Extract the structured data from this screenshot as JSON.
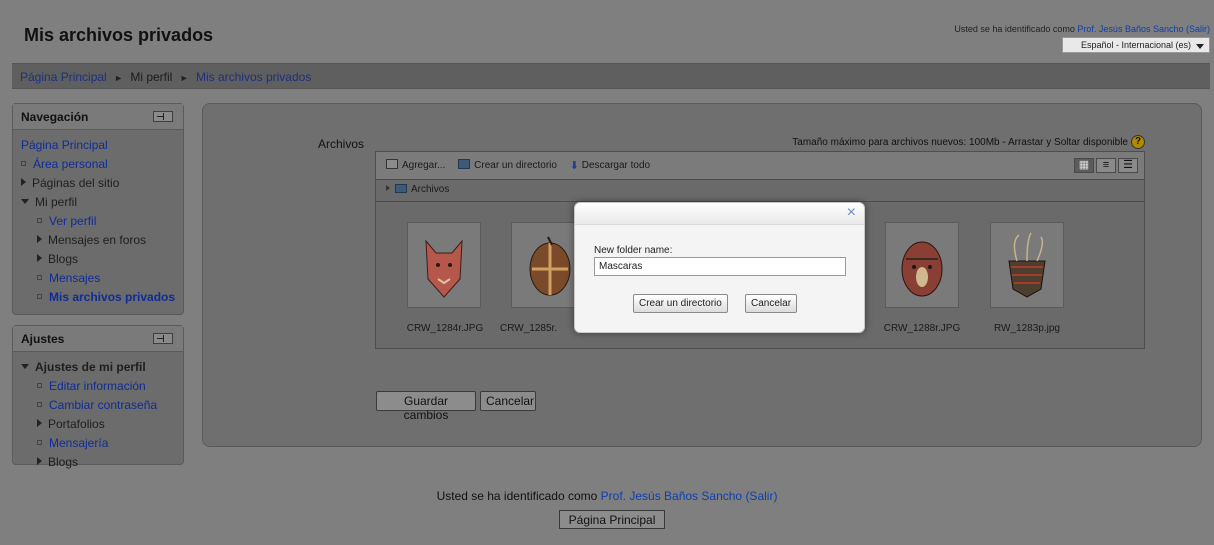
{
  "header": {
    "site_title": "Mis archivos privados",
    "login_prefix": "Usted se ha identificado como",
    "user_name": "Prof. Jesús Baños Sancho",
    "logout": "(Salir)",
    "language": "Español - Internacional (es)"
  },
  "breadcrumb": {
    "home": "Página Principal",
    "sep": "►",
    "profile": "Mi perfil",
    "current": "Mis archivos privados"
  },
  "navigation": {
    "title": "Navegación",
    "items": [
      {
        "label": "Página Principal",
        "type": "link"
      },
      {
        "label": "Área personal",
        "type": "link"
      },
      {
        "label": "Páginas del sitio",
        "type": "branch"
      },
      {
        "label": "Mi perfil",
        "type": "open"
      },
      {
        "label": "Ver perfil",
        "type": "link"
      },
      {
        "label": "Mensajes en foros",
        "type": "branch"
      },
      {
        "label": "Blogs",
        "type": "branch"
      },
      {
        "label": "Mensajes",
        "type": "link"
      },
      {
        "label": "Mis archivos privados",
        "type": "current"
      }
    ]
  },
  "settings": {
    "title": "Ajustes",
    "items": [
      {
        "label": "Ajustes de mi perfil",
        "type": "open"
      },
      {
        "label": "Editar información",
        "type": "link"
      },
      {
        "label": "Cambiar contraseña",
        "type": "link"
      },
      {
        "label": "Portafolios",
        "type": "branch"
      },
      {
        "label": "Mensajería",
        "type": "link"
      },
      {
        "label": "Blogs",
        "type": "branch"
      }
    ]
  },
  "files": {
    "label": "Archivos",
    "max_size": "Tamaño máximo para archivos nuevos: 100Mb - Arrastar y Soltar disponible",
    "help": "?",
    "toolbar": {
      "add": "Agregar...",
      "mkdir": "Crear un directorio",
      "download": "Descargar todo"
    },
    "path": "Archivos",
    "thumbnails": [
      {
        "name": "CRW_1284r.JPG",
        "color": "#b5574a"
      },
      {
        "name": "CRW_1285r.",
        "color": "#7a4a2a"
      },
      {
        "name": "CRW_1288r.JPG",
        "color": "#8a3f35"
      },
      {
        "name": "RW_1283p.jpg",
        "color": "#4d3f2f"
      }
    ],
    "save_button": "Guardar cambios",
    "cancel_button": "Cancelar"
  },
  "dialog": {
    "close": "×",
    "field_label": "New folder name:",
    "field_value": "Mascaras",
    "create_button": "Crear un directorio",
    "cancel_button": "Cancelar"
  },
  "footer": {
    "login_prefix": "Usted se ha identificado como",
    "user_name": "Prof. Jesús Baños Sancho",
    "logout": "(Salir)",
    "home_button": "Página Principal"
  }
}
